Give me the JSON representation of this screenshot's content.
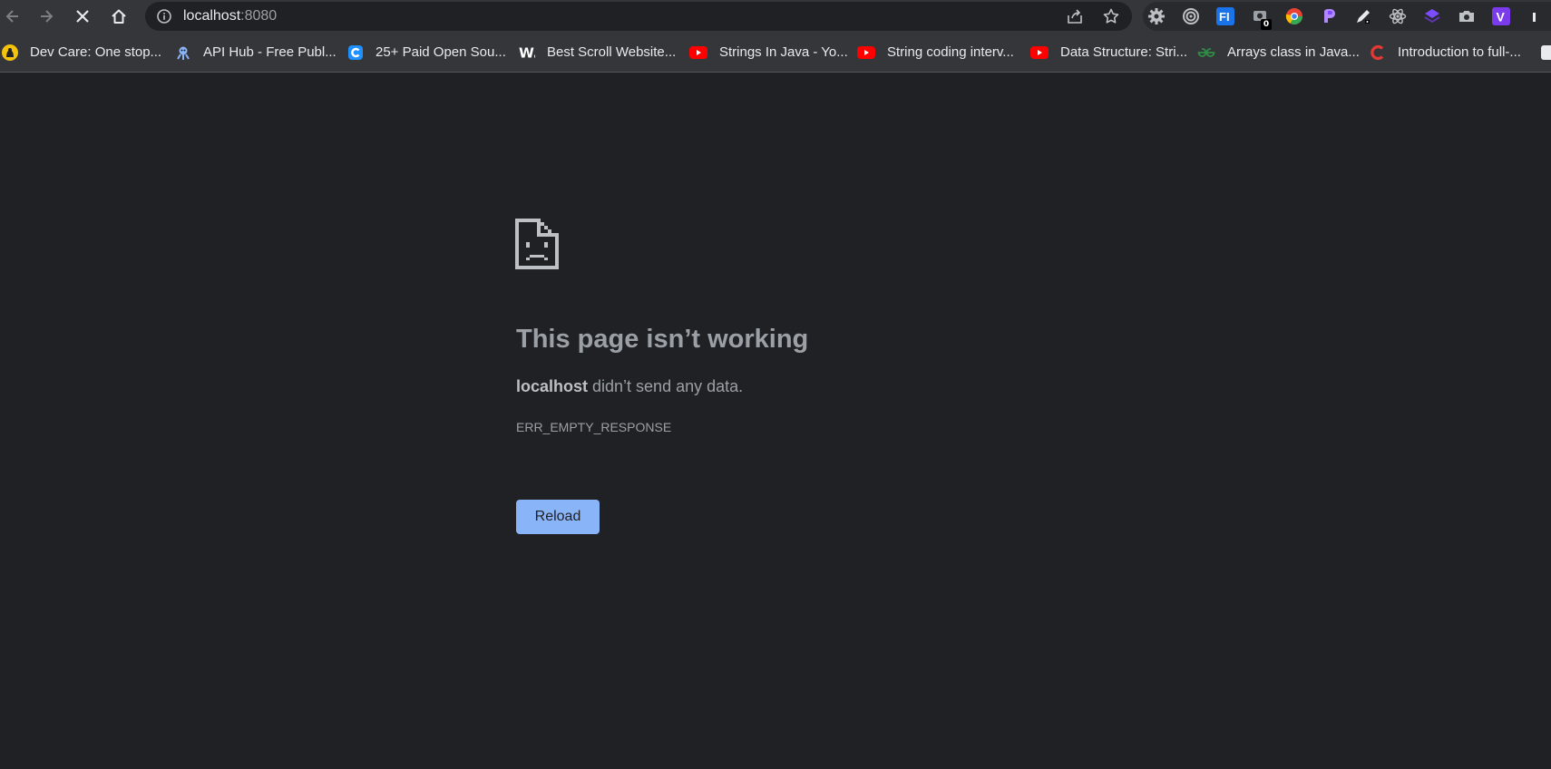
{
  "browser": {
    "url_host": "localhost",
    "url_port": ":8080",
    "nav": {
      "back_icon": "arrow-left-icon",
      "forward_icon": "arrow-right-icon",
      "stop_icon": "close-icon",
      "home_icon": "home-icon"
    },
    "extensions": {
      "badge_count": "0"
    }
  },
  "bookmarks": [
    {
      "label": "Dev Care: One stop...",
      "icon": "devcare-icon",
      "color": "#f4c20d"
    },
    {
      "label": "API Hub - Free Publ...",
      "icon": "apihub-icon",
      "color": "#8ab4f8"
    },
    {
      "label": "25+ Paid Open Sou...",
      "icon": "c-icon",
      "color": "#1e90ff"
    },
    {
      "label": "Best Scroll Website...",
      "icon": "w-icon",
      "color": "#ffffff"
    },
    {
      "label": "Strings In Java - Yo...",
      "icon": "youtube-icon",
      "color": "#ff0000"
    },
    {
      "label": "String coding interv...",
      "icon": "youtube-icon",
      "color": "#ff0000"
    },
    {
      "label": "Data Structure: Stri...",
      "icon": "youtube-icon",
      "color": "#ff0000"
    },
    {
      "label": "Arrays class in Java...",
      "icon": "gfg-icon",
      "color": "#2f8d46"
    },
    {
      "label": "Introduction to full-...",
      "icon": "codehelp-icon",
      "color": "#e53935"
    }
  ],
  "error": {
    "title": "This page isn’t working",
    "host": "localhost",
    "message": " didn’t send any data.",
    "code": "ERR_EMPTY_RESPONSE",
    "reload_label": "Reload"
  },
  "colors": {
    "page_bg": "#202124",
    "toolbar_bg": "#35363a",
    "accent": "#8ab4f8"
  }
}
